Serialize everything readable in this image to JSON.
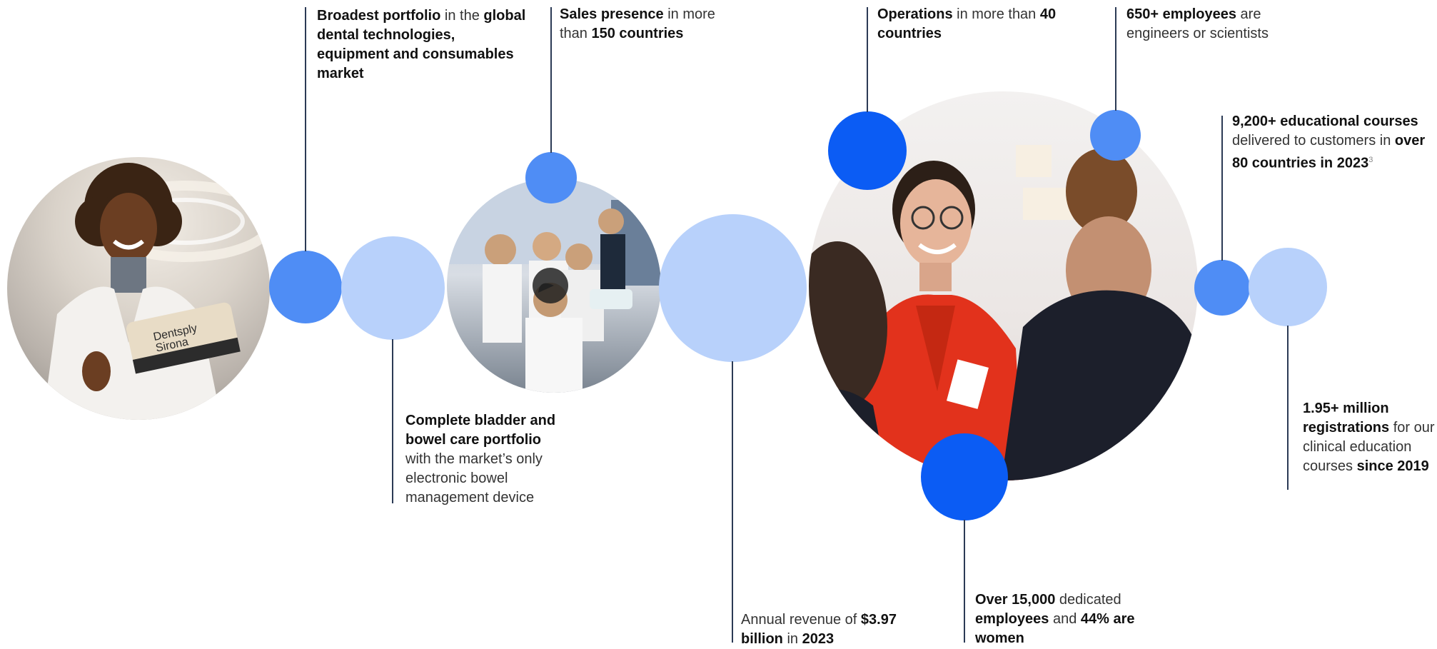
{
  "colors": {
    "light_blue": "#b8d1fb",
    "mid_blue": "#4f8df5",
    "dark_blue": "#0b5cf4",
    "line": "#2b3a55"
  },
  "photos": [
    {
      "name": "woman-with-dentsply-sirona-bag",
      "bag_text": "Dentsply Sirona"
    },
    {
      "name": "group-celebrating"
    },
    {
      "name": "smiling-woman-in-red-jacket"
    }
  ],
  "facts": {
    "portfolio": {
      "b1": "Broadest portfolio",
      "t1": " in the ",
      "b2": "global dental technologies, equipment and consumables market"
    },
    "sales": {
      "b1": "Sales presence",
      "t1": " in more than ",
      "b2": "150 countries"
    },
    "operations": {
      "b1": "Operations",
      "t1": " in more than ",
      "b2": "40 countries"
    },
    "engineers": {
      "b1": "650+ employees",
      "t1": " are engineers or scientists"
    },
    "courses": {
      "b1": "9,200+ educational courses",
      "t1": " delivered to customers in ",
      "b2": "over 80 countries in 2023",
      "sup": "3"
    },
    "bladder": {
      "b1": "Complete bladder and bowel care portfolio",
      "t1": " with the market’s only electronic bowel management device"
    },
    "revenue": {
      "t1": "Annual revenue of ",
      "b1": "$3.97 billion",
      "t2": " in ",
      "b2": "2023"
    },
    "employees": {
      "b1": "Over 15,000",
      "t1": " dedicated ",
      "b2": "employees",
      "t2": " and ",
      "b3": "44% are women"
    },
    "registrations": {
      "b1": "1.95+ million registrations",
      "t1": " for our clinical education courses ",
      "b2": "since 2019"
    }
  }
}
